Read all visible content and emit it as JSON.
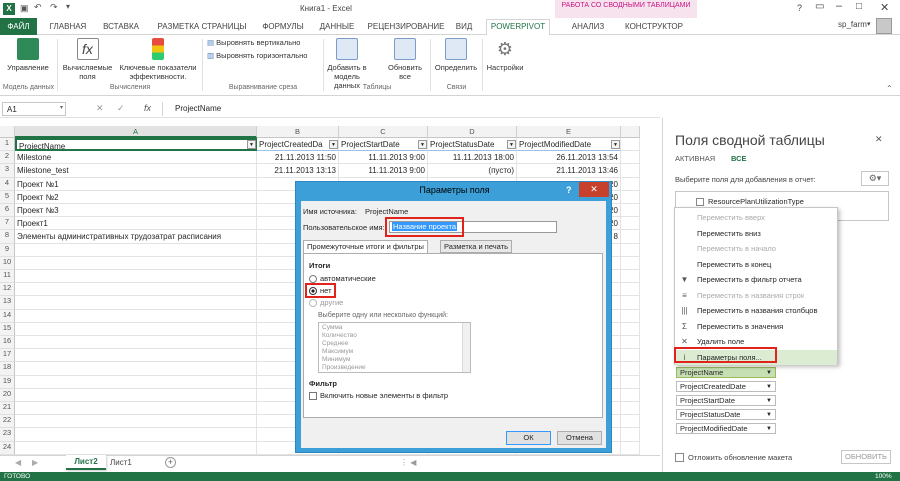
{
  "title": {
    "text": "Книга1 - Excel",
    "context_tab": "РАБОТА СО СВОДНЫМИ ТАБЛИЦАМИ",
    "help": "?",
    "user": "sp_farm"
  },
  "ribbon_tabs": [
    "ФАЙЛ",
    "ГЛАВНАЯ",
    "ВСТАВКА",
    "РАЗМЕТКА СТРАНИЦЫ",
    "ФОРМУЛЫ",
    "ДАННЫЕ",
    "РЕЦЕНЗИРОВАНИЕ",
    "ВИД",
    "POWERPIVOT",
    "АНАЛИЗ",
    "КОНСТРУКТОР"
  ],
  "ribbon": {
    "manage": "Управление",
    "calc_fields": "Вычисляемые поля",
    "kpi": "Ключевые показатели эффективности.",
    "align_v": "Выровнять вертикально",
    "align_h": "Выровнять горизонтально",
    "add_model": "Добавить в модель данных",
    "refresh_all": "Обновить все",
    "detect": "Определить",
    "settings": "Настройки",
    "grp_model": "Модель данных",
    "grp_calc": "Вычисления",
    "grp_slicer": "Выравнивание среза",
    "grp_tables": "Таблицы",
    "grp_rel": "Связи"
  },
  "formula_bar": {
    "name_box": "A1",
    "fx": "fx",
    "value": "ProjectName"
  },
  "columns": [
    "A",
    "B",
    "C",
    "D",
    "E"
  ],
  "header_row": [
    "ProjectName",
    "ProjectCreatedDa",
    "ProjectStartDate",
    "ProjectStatusDate",
    "ProjectModifiedDate"
  ],
  "rows": [
    [
      "Milestone",
      "21.11.2013 11:50",
      "11.11.2013 9:00",
      "11.11.2013 18:00",
      "26.11.2013 13:54"
    ],
    [
      "Milestone_test",
      "21.11.2013 13:13",
      "11.11.2013 9:00",
      "(пусто)",
      "21.11.2013 13:46"
    ],
    [
      "Проект №1",
      "26.11",
      "",
      "",
      "20"
    ],
    [
      "Проект №2",
      "26.11",
      "",
      "",
      "20"
    ],
    [
      "Проект №3",
      "26.11",
      "",
      "",
      "20"
    ],
    [
      "Проект1",
      "18.11",
      "",
      "",
      "20"
    ],
    [
      "Элементы административных трудозатрат расписания",
      "17.11",
      "",
      "",
      "8"
    ]
  ],
  "row_numbers": [
    "1",
    "2",
    "3",
    "4",
    "5",
    "6",
    "7",
    "8",
    "9",
    "10",
    "11",
    "12",
    "13",
    "14",
    "15",
    "16",
    "17",
    "18",
    "19",
    "20",
    "21",
    "22",
    "23",
    "24",
    "25"
  ],
  "sheet_tabs": [
    "Лист2",
    "Лист1"
  ],
  "status": "ГОТОВО",
  "zoom": "100%",
  "dialog": {
    "title": "Параметры поля",
    "source_label": "Имя источника:",
    "source_value": "ProjectName",
    "custom_label": "Пользовательское имя:",
    "custom_value": "Название проекта",
    "tab1": "Промежуточные итоги и фильтры",
    "tab2": "Разметка и печать",
    "subtotals": "Итоги",
    "auto": "автоматические",
    "none": "нет",
    "custom": "другие",
    "choose": "Выберите одну или несколько функций:",
    "functions": [
      "Сумма",
      "Количество",
      "Среднее",
      "Максимум",
      "Минимум",
      "Произведение"
    ],
    "filter": "Фильтр",
    "include_new": "Включить новые элементы в фильтр",
    "ok": "ОК",
    "cancel": "Отмена"
  },
  "pane": {
    "title": "Поля сводной таблицы",
    "tab_active": "АКТИВНАЯ",
    "tab_all": "ВСЕ",
    "choose": "Выберите поля для добавления в отчет:",
    "field1": "ResourcePlanUtilizationType",
    "defer": "Отложить обновление макета",
    "update": "ОБНОВИТЬ",
    "row_fields": [
      "ProjectName",
      "ProjectCreatedDate",
      "ProjectStartDate",
      "ProjectStatusDate",
      "ProjectModifiedDate"
    ]
  },
  "context_menu": [
    {
      "label": "Переместить вверх",
      "icon": "",
      "disabled": true
    },
    {
      "label": "Переместить вниз",
      "icon": "",
      "disabled": false
    },
    {
      "label": "Переместить в начало",
      "icon": "",
      "disabled": true
    },
    {
      "label": "Переместить в конец",
      "icon": "",
      "disabled": false
    },
    {
      "label": "Переместить в фильтр отчета",
      "icon": "▼",
      "disabled": false
    },
    {
      "label": "Переместить в названия строк",
      "icon": "≡",
      "disabled": true
    },
    {
      "label": "Переместить в названия столбцов",
      "icon": "|||",
      "disabled": false
    },
    {
      "label": "Переместить в значения",
      "icon": "Σ",
      "disabled": false
    },
    {
      "label": "Удалить поле",
      "icon": "✕",
      "disabled": false
    },
    {
      "label": "Параметры поля...",
      "icon": "i",
      "disabled": false
    }
  ],
  "colors": {
    "excel_green": "#217346",
    "powerpivot": "#217346",
    "context_pink": "#c71585",
    "dialog_blue": "#3c9fd8",
    "highlight_red": "#e0231b"
  }
}
